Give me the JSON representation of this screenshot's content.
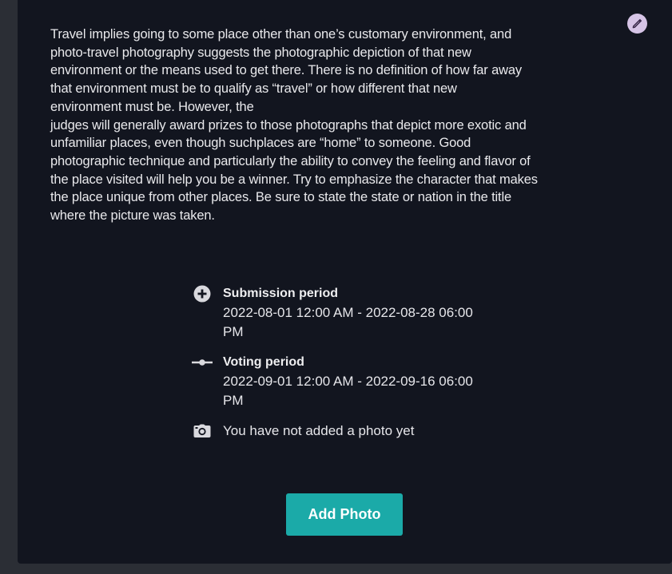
{
  "description": {
    "paragraph1": "Travel implies going to some place other than one’s customary environment, and\nphoto-travel photography suggests the photographic depiction of that new\nenvironment or the means used to get there. There is no definition of how far away\nthat environment must be to qualify as “travel” or how different that new\nenvironment must be. However, the",
    "paragraph2": "judges will generally award prizes to those photographs that depict more exotic and\nunfamiliar places, even though suchplaces are “home” to someone. Good\nphotographic technique and particularly the ability to convey the feeling and flavor of\nthe place visited will help you be a winner. Try to emphasize the character that makes\nthe place unique from other places. Be sure to state the state or nation in the title\nwhere the picture was taken."
  },
  "submission": {
    "title": "Submission period",
    "value": "2022-08-01 12:00 AM - 2022-08-28 06:00 PM"
  },
  "voting": {
    "title": "Voting period",
    "value": "2022-09-01 12:00 AM - 2022-09-16 06:00 PM"
  },
  "photo_status": "You have not added a photo yet",
  "add_photo_label": "Add Photo",
  "icons": {
    "edit": "pencil-icon",
    "submission": "plus-circle-icon",
    "voting": "timeline-icon",
    "photo": "camera-icon"
  },
  "colors": {
    "background": "#2b2e35",
    "card": "#12151f",
    "accent": "#1baaa8",
    "edit_badge": "#d6c4e6",
    "text": "#e9e9ec"
  }
}
